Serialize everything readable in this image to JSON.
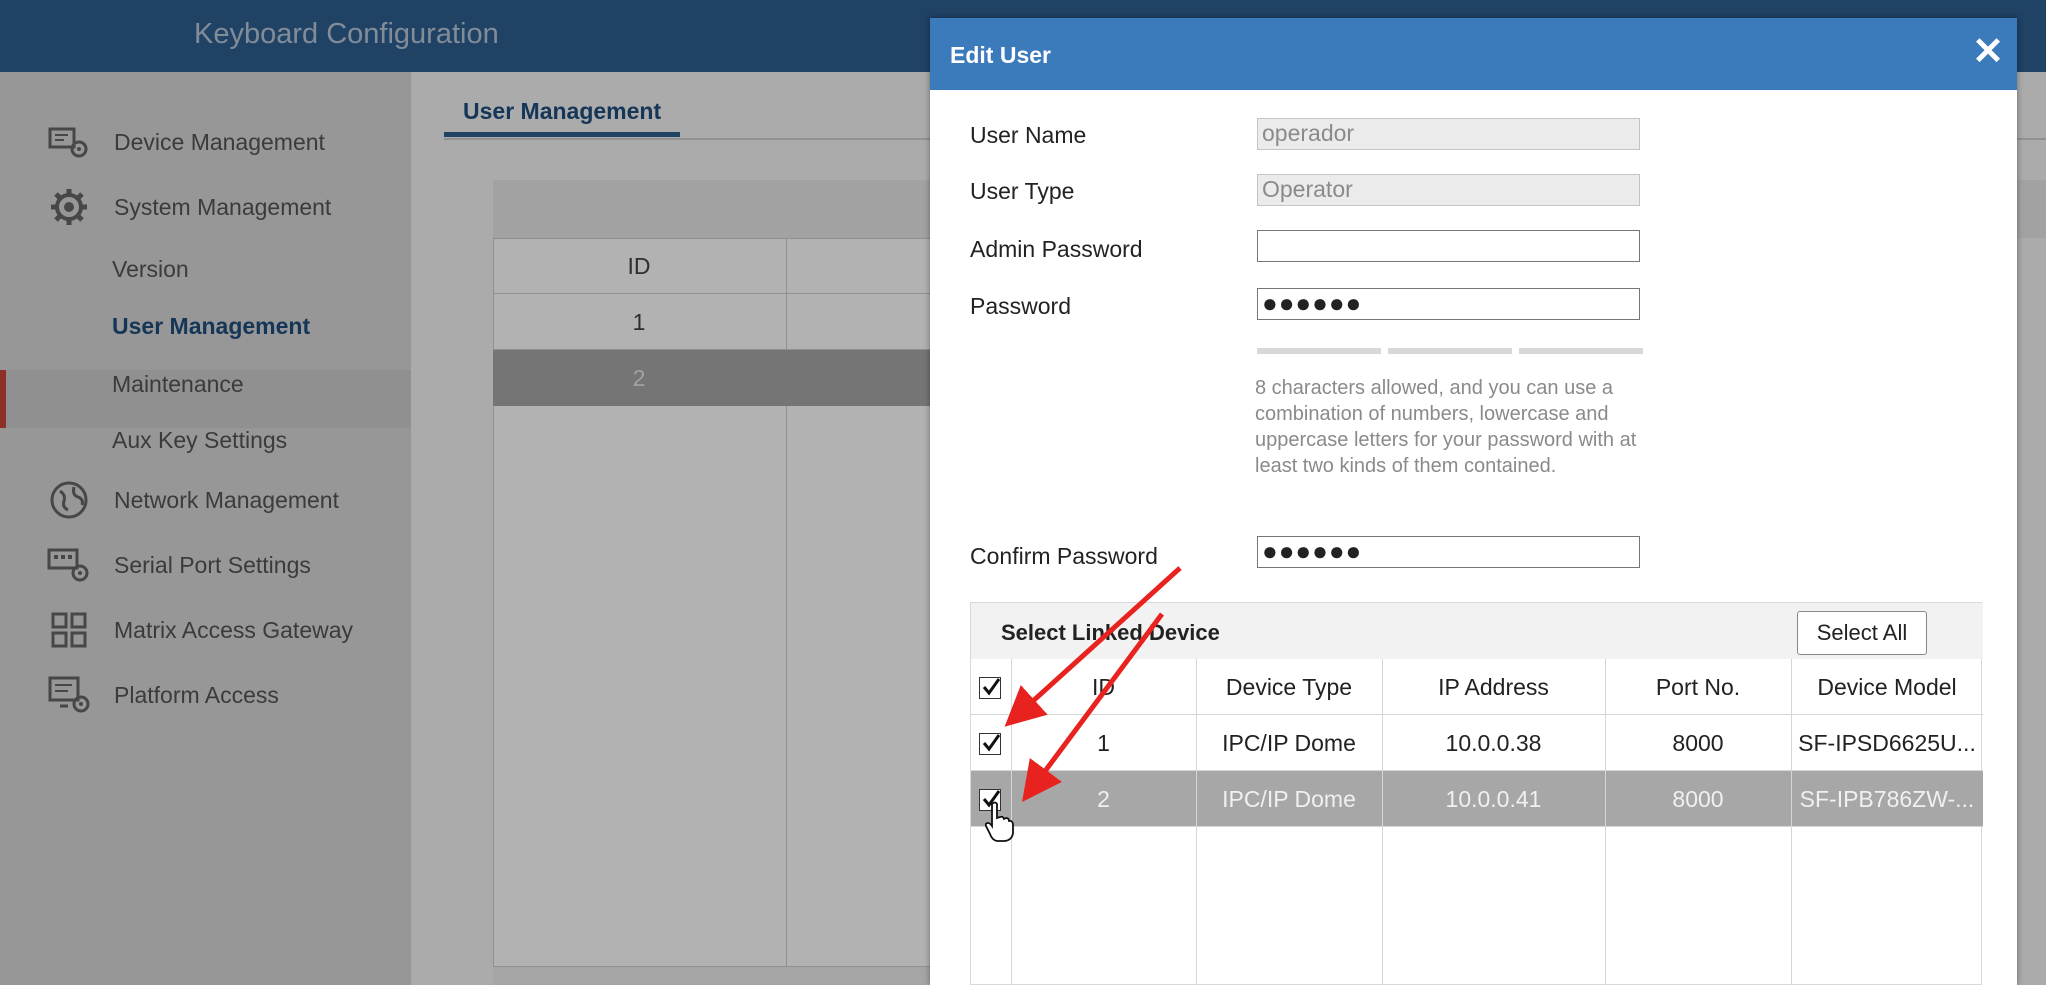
{
  "app": {
    "title": "Keyboard Configuration"
  },
  "sidebar": {
    "items": [
      {
        "label": "Device Management",
        "icon": "device-management-icon"
      },
      {
        "label": "System Management",
        "icon": "gear-icon"
      },
      {
        "label": "Network Management",
        "icon": "globe-icon"
      },
      {
        "label": "Serial Port Settings",
        "icon": "serial-port-icon"
      },
      {
        "label": "Matrix Access Gateway",
        "icon": "grid-icon"
      },
      {
        "label": "Platform Access",
        "icon": "platform-icon"
      }
    ],
    "subitems": [
      "Version",
      "User Management",
      "Maintenance",
      "Aux Key Settings"
    ],
    "active": "User Management"
  },
  "main": {
    "tab": "User Management",
    "table": {
      "header": "ID",
      "rows": [
        "1",
        "2"
      ]
    }
  },
  "dialog": {
    "title": "Edit User",
    "close": "✕",
    "user_name_label": "User Name",
    "user_name": "operador",
    "user_type_label": "User Type",
    "user_type": "Operator",
    "admin_password_label": "Admin Password",
    "admin_password": "",
    "password_label": "Password",
    "password": "●●●●●●",
    "password_hint": "8 characters allowed, and you can use a combination of numbers, lowercase and uppercase letters for your password with at least two kinds of them contained.",
    "confirm_password_label": "Confirm Password",
    "confirm_password": "●●●●●●",
    "linked_title": "Select Linked Device",
    "select_all": "Select All",
    "columns": [
      "ID",
      "Device Type",
      "IP Address",
      "Port No.",
      "Device Model"
    ],
    "devices": [
      {
        "id": "1",
        "type": "IPC/IP Dome",
        "ip": "10.0.0.38",
        "port": "8000",
        "model": "SF-IPSD6625U...",
        "checked": true
      },
      {
        "id": "2",
        "type": "IPC/IP Dome",
        "ip": "10.0.0.41",
        "port": "8000",
        "model": "SF-IPB786ZW-...",
        "checked": true
      }
    ]
  },
  "colors": {
    "header_blue": "#2f5f91",
    "dialog_header": "#3b7abb",
    "active_accent": "#c9453a",
    "annotation_arrow": "#e8231f"
  }
}
